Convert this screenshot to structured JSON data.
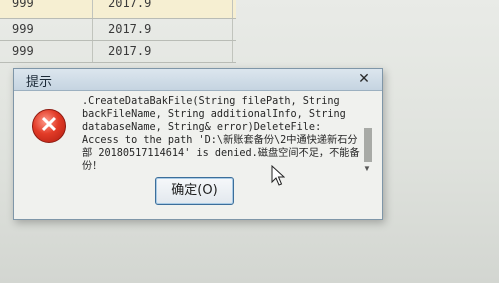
{
  "table": {
    "rows": [
      {
        "col1": "999",
        "col2": "2017.9"
      },
      {
        "col1": "999",
        "col2": "2017.9"
      },
      {
        "col1": "999",
        "col2": "2017.9"
      }
    ]
  },
  "dialog": {
    "title": "提示",
    "close_symbol": "✕",
    "message": ".CreateDataBakFile(String filePath, String backFileName, String additionalInfo, String databaseName, String& error)DeleteFile: Access to the path 'D:\\新账套备份\\2中通快递新石分部 20180517114614' is denied.磁盘空间不足，不能备份！",
    "ok_button": "确定(O)"
  },
  "icons": {
    "error": "error-icon",
    "cursor": "mouse-pointer-icon"
  }
}
